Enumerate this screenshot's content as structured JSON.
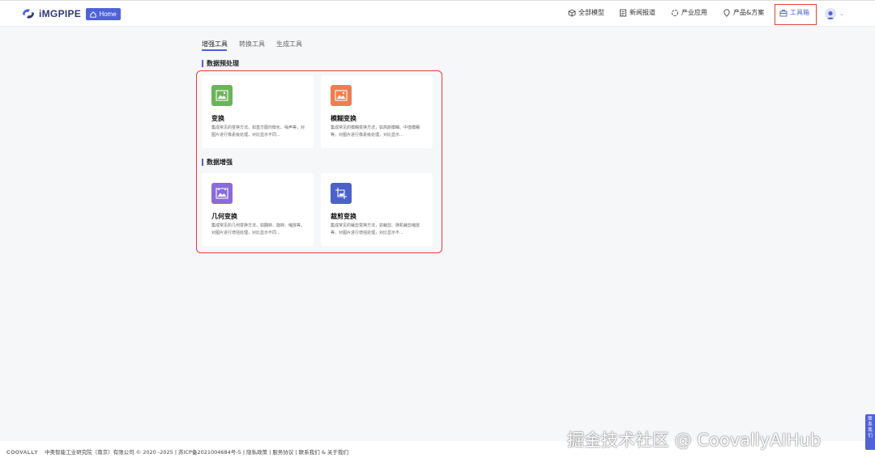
{
  "header": {
    "logo_text": "iMGPIPE",
    "home_label": "Home",
    "nav": [
      {
        "label": "全部模型",
        "icon": "cube-icon"
      },
      {
        "label": "新闻报道",
        "icon": "news-icon"
      },
      {
        "label": "产业应用",
        "icon": "industry-icon"
      },
      {
        "label": "产品&方案",
        "icon": "location-pin-icon"
      },
      {
        "label": "工具箱",
        "icon": "toolbox-icon"
      }
    ]
  },
  "tabs": [
    "增强工具",
    "转换工具",
    "生成工具"
  ],
  "sections": [
    {
      "title": "数据预处理",
      "cards": [
        {
          "title": "变换",
          "desc": "集成常见的变换方法。如直方图均衡化、噪声等，对图片进行像素级处理，对比显示不同...",
          "color": "#6db35a"
        },
        {
          "title": "模糊变换",
          "desc": "集成常见的模糊变换方法，如高斯模糊、中值模糊等，对图片进行像素级处理，对比显示...",
          "color": "#ee7e4f"
        }
      ]
    },
    {
      "title": "数据增强",
      "cards": [
        {
          "title": "几何变换",
          "desc": "集成常见的几何变换方法，如翻转、旋转、缩放等，对图片进行增强处理，对比显示不同...",
          "color": "#8a6bd9"
        },
        {
          "title": "裁剪变换",
          "desc": "集成常见的裁剪变换方法，如裁剪、随机裁剪缩放等，对图片进行增强处理，对比显示不...",
          "color": "#4a62c9"
        }
      ]
    }
  ],
  "footer": {
    "brand": "COOVALLY",
    "text": "中奥智能工业研究院（南京）有限公司 © 2020 -2025 | 苏ICP备2021004684号-5 | 隐私政策 | 服务协议 | 联系我们  &  关于我们"
  },
  "watermark": "掘金技术社区 @ CoovallyAIHub",
  "contact_label": "联系我们",
  "colors": {
    "accent": "#4f63d6",
    "highlight": "#e0403a"
  }
}
